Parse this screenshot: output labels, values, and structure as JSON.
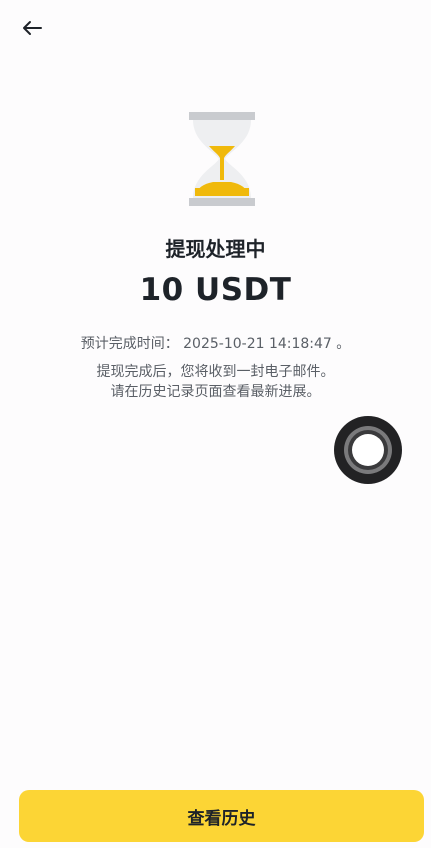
{
  "header": {
    "back_icon": "arrow-left-icon"
  },
  "status": {
    "icon": "hourglass-icon",
    "accent_color": "#f0b90b",
    "title": "提现处理中",
    "amount": "10 USDT",
    "eta_line": "预计完成时间： 2025-10-21 14:18:47 。",
    "email_line": "提现完成后，您将收到一封电子邮件。",
    "history_line": "请在历史记录页面查看最新进展。"
  },
  "floating_button": {
    "icon": "assistive-touch-icon"
  },
  "footer": {
    "view_history_label": "查看历史",
    "button_color": "#fcd535"
  }
}
